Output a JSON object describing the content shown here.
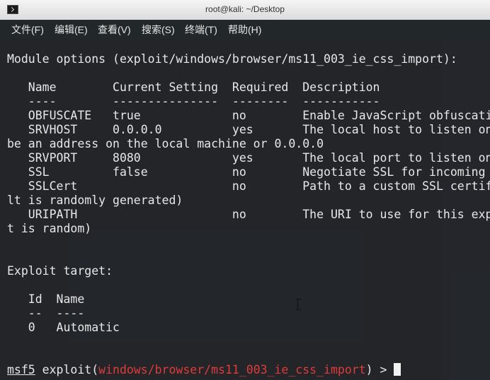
{
  "window": {
    "title": "root@kali: ~/Desktop"
  },
  "menu": [
    {
      "label": "文件(F)"
    },
    {
      "label": "编辑(E)"
    },
    {
      "label": "查看(V)"
    },
    {
      "label": "搜索(S)"
    },
    {
      "label": "终端(T)"
    },
    {
      "label": "帮助(H)"
    }
  ],
  "terminal": {
    "lines": [
      "Module options (exploit/windows/browser/ms11_003_ie_css_import):",
      "",
      "   Name        Current Setting  Required  Description",
      "   ----        ---------------  --------  -----------",
      "   OBFUSCATE   true             no        Enable JavaScript obfuscati",
      "   SRVHOST     0.0.0.0          yes       The local host to listen on",
      "be an address on the local machine or 0.0.0.0",
      "   SRVPORT     8080             yes       The local port to listen on",
      "   SSL         false            no        Negotiate SSL for incoming c",
      "   SSLCert                      no        Path to a custom SSL certif",
      "lt is randomly generated)",
      "   URIPATH                      no        The URI to use for this exp",
      "t is random)",
      "",
      "",
      "Exploit target:",
      "",
      "   Id  Name",
      "   --  ----",
      "   0   Automatic",
      "",
      ""
    ],
    "prompt": {
      "tool": "msf5",
      "command": " exploit(",
      "module": "windows/browser/ms11_003_ie_css_import",
      "suffix": ") > "
    }
  },
  "colors": {
    "terminal_bg": "#222529",
    "text": "#e8e8e8",
    "module_highlight": "#e03b3b",
    "titlebar": "#e6e6e6"
  }
}
